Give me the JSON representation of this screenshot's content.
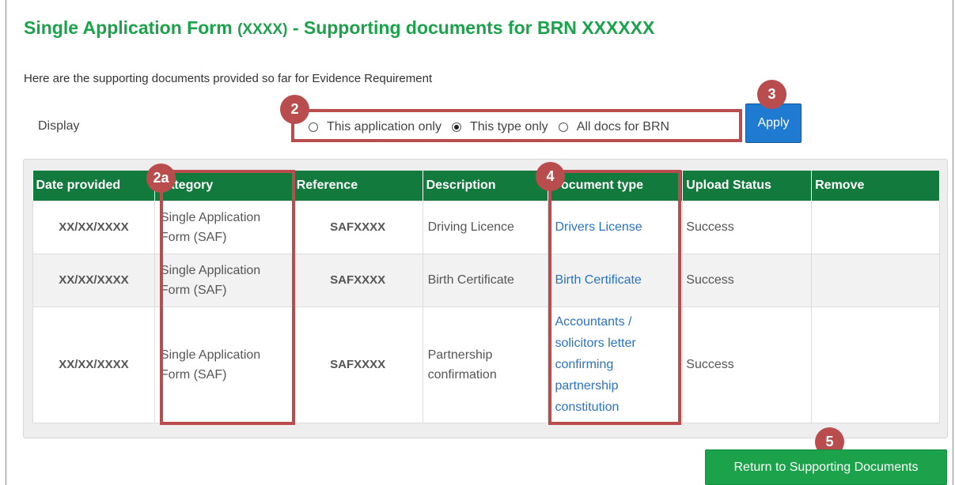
{
  "header": {
    "title_main": "Single Application Form",
    "title_code": "(XXXX)",
    "title_mid": "- Supporting documents for BRN",
    "title_brn": "XXXXXX"
  },
  "intro_text": "Here are the supporting documents provided so far for Evidence Requirement",
  "display": {
    "label": "Display",
    "options": [
      {
        "label": "This application only",
        "checked": false
      },
      {
        "label": "This type only",
        "checked": true
      },
      {
        "label": "All docs for BRN",
        "checked": false
      }
    ],
    "apply_label": "Apply"
  },
  "table": {
    "columns": [
      "Date provided",
      "Category",
      "Reference",
      "Description",
      "Document type",
      "Upload Status",
      "Remove"
    ],
    "rows": [
      {
        "date": "XX/XX/XXXX",
        "category_line1": "Single Application",
        "category_line2": "Form (SAF)",
        "reference": "SAFXXXX",
        "description": "Driving Licence",
        "doc_type": "Drivers License",
        "status": "Success",
        "remove": ""
      },
      {
        "date": "XX/XX/XXXX",
        "category_line1": "Single Application",
        "category_line2": "Form (SAF)",
        "reference": "SAFXXXX",
        "description": "Birth Certificate",
        "doc_type": "Birth Certificate",
        "status": "Success",
        "remove": ""
      },
      {
        "date": "XX/XX/XXXX",
        "category_line1": "Single Application",
        "category_line2": "Form (SAF)",
        "reference": "SAFXXXX",
        "description_line1": "Partnership",
        "description_line2": "confirmation",
        "doc_type_lines": [
          "Accountants /",
          "solicitors letter",
          "confirming",
          "partnership",
          "constitution"
        ],
        "status": "Success",
        "remove": ""
      }
    ]
  },
  "callouts": {
    "b2": "2",
    "b2a": "2a",
    "b3": "3",
    "b4": "4",
    "b5": "5"
  },
  "return_label": "Return to Supporting Documents",
  "colors": {
    "title_green": "#1aa34a",
    "header_green": "#127a3c",
    "apply_blue": "#1f7ad1",
    "link_blue": "#2a72c2",
    "callout_red": "#b94d4d",
    "return_green": "#1ba24a"
  }
}
